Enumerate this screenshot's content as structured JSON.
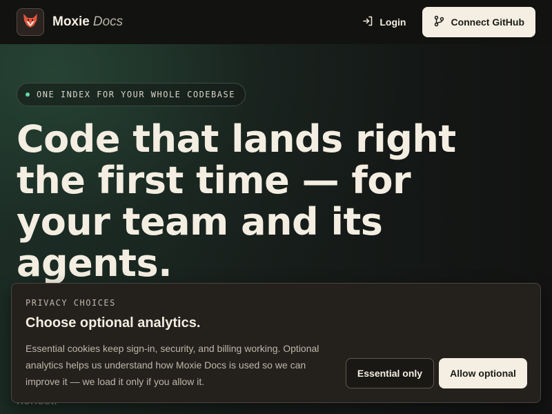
{
  "header": {
    "logo_icon": "fox-icon",
    "brand_name": "Moxie",
    "brand_suffix": "Docs",
    "login_label": "Login",
    "login_icon": "login-arrow-icon",
    "connect_label": "Connect GitHub",
    "connect_icon": "git-branch-icon"
  },
  "hero": {
    "pill_text": "ONE INDEX FOR YOUR WHOLE CODEBASE",
    "headline": "Code that lands right the first time — for your team and its agents.",
    "subtext_visible": "honest."
  },
  "cookie_banner": {
    "eyebrow": "PRIVACY CHOICES",
    "title": "Choose optional analytics.",
    "body": "Essential cookies keep sign-in, security, and billing working. Optional analytics helps us understand how Moxie Docs is used so we can improve it — we load it only if you allow it.",
    "essential_label": "Essential only",
    "allow_label": "Allow optional"
  },
  "colors": {
    "accent_green": "#66d6a8",
    "cream": "#f4efe2",
    "logo_fox": "#e2553f"
  }
}
